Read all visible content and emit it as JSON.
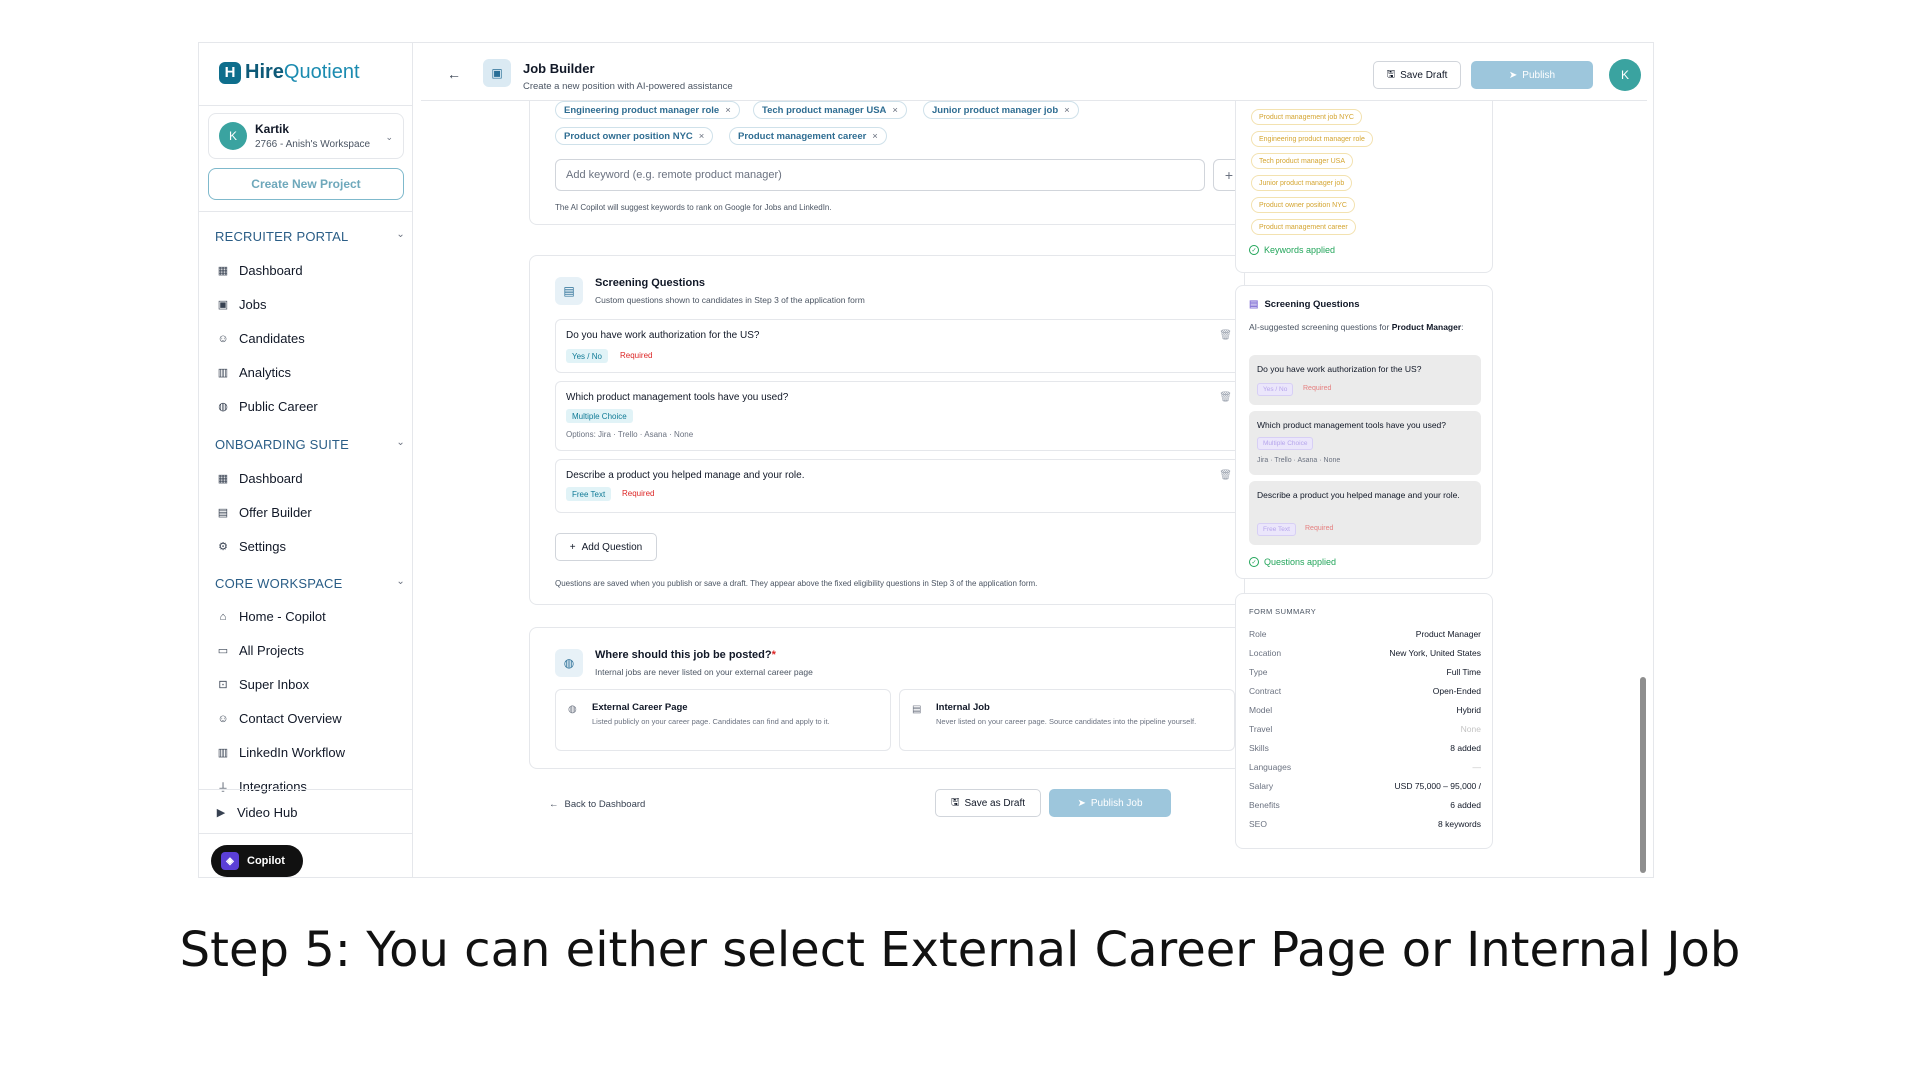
{
  "logo": {
    "part1": "Hire",
    "part2": "Quotient"
  },
  "workspace": {
    "avatar": "K",
    "name": "Kartik",
    "sub": "2766 - Anish's Workspace"
  },
  "sidebar": {
    "create_label": "Create New Project",
    "sections": [
      {
        "title": "RECRUITER PORTAL",
        "items": [
          {
            "label": "Dashboard",
            "icon": "grid-icon"
          },
          {
            "label": "Jobs",
            "icon": "briefcase-icon"
          },
          {
            "label": "Candidates",
            "icon": "users-icon"
          },
          {
            "label": "Analytics",
            "icon": "bar-chart-icon"
          },
          {
            "label": "Public Career",
            "icon": "globe-icon"
          }
        ]
      },
      {
        "title": "ONBOARDING SUITE",
        "items": [
          {
            "label": "Dashboard",
            "icon": "grid-icon"
          },
          {
            "label": "Offer Builder",
            "icon": "document-icon"
          },
          {
            "label": "Settings",
            "icon": "gear-icon"
          }
        ]
      },
      {
        "title": "CORE WORKSPACE",
        "items": [
          {
            "label": "Home - Copilot",
            "icon": "home-icon"
          },
          {
            "label": "All Projects",
            "icon": "folder-icon"
          },
          {
            "label": "Super Inbox",
            "icon": "inbox-icon"
          },
          {
            "label": "Contact Overview",
            "icon": "contact-icon"
          },
          {
            "label": "LinkedIn Workflow",
            "icon": "linkedin-icon"
          },
          {
            "label": "Integrations",
            "icon": "plug-icon"
          }
        ]
      }
    ],
    "video_hub": "Video Hub",
    "copilot": "Copilot"
  },
  "header": {
    "title": "Job Builder",
    "subtitle": "Create a new position with AI-powered assistance",
    "save_draft": "Save Draft",
    "publish": "Publish",
    "avatar": "K"
  },
  "keywords": {
    "chips": [
      "Engineering product manager role",
      "Tech product manager USA",
      "Junior product manager job",
      "Product owner position NYC",
      "Product management career"
    ],
    "placeholder": "Add keyword (e.g. remote product manager)",
    "note": "The AI Copilot will suggest keywords to rank on Google for Jobs and LinkedIn."
  },
  "screening": {
    "title": "Screening Questions",
    "subtitle": "Custom questions shown to candidates in Step 3 of the application form",
    "questions": [
      {
        "text": "Do you have work authorization for the US?",
        "type": "Yes / No",
        "required": "Required"
      },
      {
        "text": "Which product management tools have you used?",
        "type": "Multiple Choice",
        "options": "Options: Jira · Trello · Asana · None"
      },
      {
        "text": "Describe a product you helped manage and your role.",
        "type": "Free Text",
        "required": "Required"
      }
    ],
    "add_label": "Add Question",
    "note": "Questions are saved when you publish or save a draft. They appear above the fixed eligibility questions in Step 3 of the application form."
  },
  "posting": {
    "title": "Where should this job be posted?",
    "star": "*",
    "subtitle": "Internal jobs are never listed on your external career page",
    "external": {
      "title": "External Career Page",
      "desc": "Listed publicly on your career page. Candidates can find and apply to it."
    },
    "internal": {
      "title": "Internal Job",
      "desc": "Never listed on your career page. Source candidates into the pipeline yourself."
    }
  },
  "footer": {
    "back": "Back to Dashboard",
    "save": "Save as Draft",
    "publish": "Publish Job"
  },
  "right": {
    "kw_chips": [
      "Product management job NYC",
      "Engineering product manager role",
      "Tech product manager USA",
      "Junior product manager job",
      "Product owner position NYC",
      "Product management career"
    ],
    "kw_applied": "Keywords applied",
    "sq_title": "Screening Questions",
    "sq_intro": "AI-suggested screening questions for",
    "sq_role": "Product Manager",
    "sq_colon": ":",
    "sq_items": [
      {
        "text": "Do you have work authorization for the US?",
        "type": "Yes / No",
        "required": "Required"
      },
      {
        "text": "Which product management tools have you used?",
        "type": "Multiple Choice",
        "options": "Jira · Trello · Asana · None"
      },
      {
        "text": "Describe a product you helped manage and your role.",
        "type": "Free Text",
        "required": "Required"
      }
    ],
    "sq_applied": "Questions applied",
    "summary_title": "FORM SUMMARY",
    "summary": [
      {
        "k": "Role",
        "v": "Product Manager"
      },
      {
        "k": "Location",
        "v": "New York, United States"
      },
      {
        "k": "Type",
        "v": "Full Time"
      },
      {
        "k": "Contract",
        "v": "Open-Ended"
      },
      {
        "k": "Model",
        "v": "Hybrid"
      },
      {
        "k": "Travel",
        "v": "None"
      },
      {
        "k": "Skills",
        "v": "8 added"
      },
      {
        "k": "Languages",
        "v": "—"
      },
      {
        "k": "Salary",
        "v": "USD 75,000 – 95,000 /"
      },
      {
        "k": "Benefits",
        "v": "6 added"
      },
      {
        "k": "SEO",
        "v": "8 keywords"
      }
    ]
  },
  "caption": "Step 5: You can either select External Career Page or Internal Job"
}
